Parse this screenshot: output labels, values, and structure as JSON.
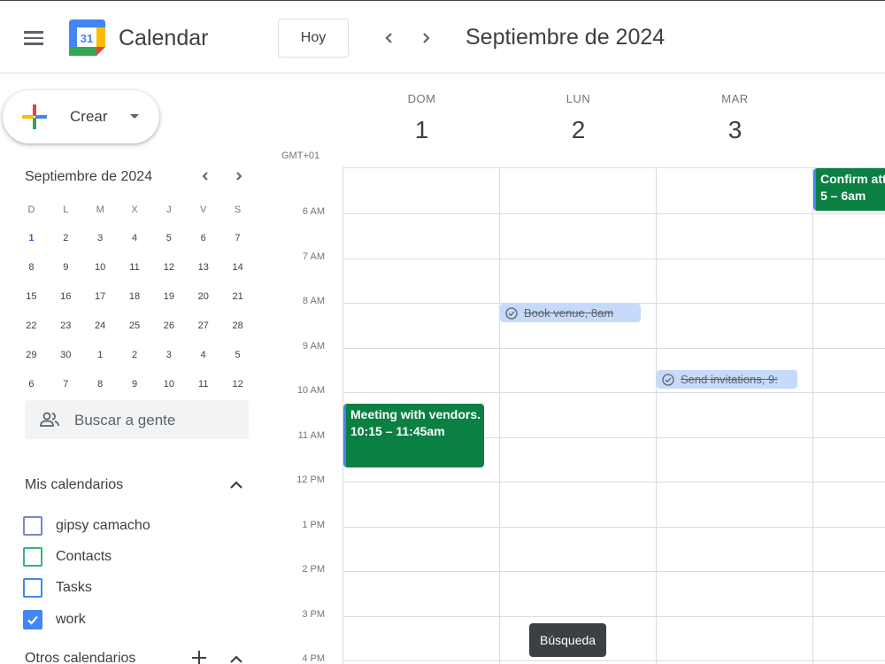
{
  "header": {
    "app_title": "Calendar",
    "logo_day": "31",
    "today_label": "Hoy",
    "month_title": "Septiembre de 2024"
  },
  "sidebar": {
    "create_label": "Crear",
    "mini_calendar": {
      "title": "Septiembre de 2024",
      "weekdays": [
        "D",
        "L",
        "M",
        "X",
        "J",
        "V",
        "S"
      ],
      "weeks": [
        [
          "1",
          "2",
          "3",
          "4",
          "5",
          "6",
          "7"
        ],
        [
          "8",
          "9",
          "10",
          "11",
          "12",
          "13",
          "14"
        ],
        [
          "15",
          "16",
          "17",
          "18",
          "19",
          "20",
          "21"
        ],
        [
          "22",
          "23",
          "24",
          "25",
          "26",
          "27",
          "28"
        ],
        [
          "29",
          "30",
          "1",
          "2",
          "3",
          "4",
          "5"
        ],
        [
          "6",
          "7",
          "8",
          "9",
          "10",
          "11",
          "12"
        ]
      ]
    },
    "people_search_label": "Buscar a gente",
    "my_calendars": {
      "title": "Mis calendarios",
      "items": [
        {
          "label": "gipsy camacho",
          "color": "#7986cb",
          "checked": false
        },
        {
          "label": "Contacts",
          "color": "#33b679",
          "checked": false
        },
        {
          "label": "Tasks",
          "color": "#4285f4",
          "checked": false
        },
        {
          "label": "work",
          "color": "#4285f4",
          "checked": true
        }
      ]
    },
    "other_calendars": {
      "title": "Otros calendarios"
    }
  },
  "week": {
    "timezone": "GMT+01",
    "days": [
      {
        "name": "DOM",
        "num": "1"
      },
      {
        "name": "LUN",
        "num": "2"
      },
      {
        "name": "MAR",
        "num": "3"
      }
    ],
    "hour_labels": [
      "6 AM",
      "7 AM",
      "8 AM",
      "9 AM",
      "10 AM",
      "11 AM",
      "12 PM",
      "1 PM",
      "2 PM",
      "3 PM",
      "4 PM"
    ],
    "events": [
      {
        "title": "Meeting with vendors.",
        "time": "10:15 – 11:45am",
        "color": "#0b8043"
      },
      {
        "title": "Confirm att",
        "time": "5 – 6am",
        "color": "#0b8043"
      }
    ],
    "tasks": [
      {
        "title": "Book venue, 8am"
      },
      {
        "title": "Send invitations, 9:"
      }
    ]
  },
  "tooltip": {
    "text": "Búsqueda"
  }
}
